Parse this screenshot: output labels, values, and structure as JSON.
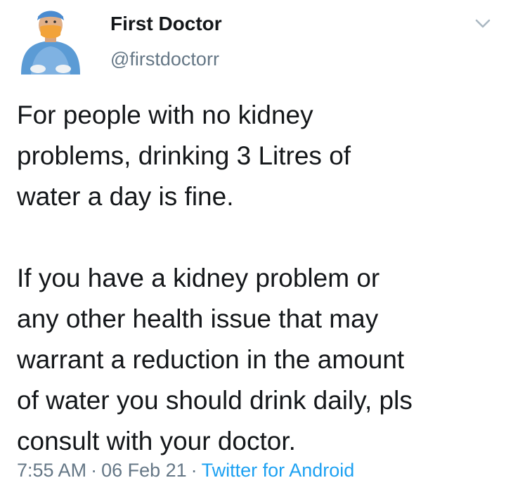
{
  "author": {
    "display_name": "First Doctor",
    "handle": "@firstdoctorr",
    "avatar_icon": "doctor-avatar-icon"
  },
  "menu": {
    "icon": "chevron-down-icon"
  },
  "tweet": {
    "paragraphs": [
      "For people with no kidney\nproblems, drinking 3 Litres of\nwater a day is fine.",
      "If you have a kidney problem or\nany other health issue that may\nwarrant a reduction in the amount\nof water you should drink daily, pls\nconsult with your doctor."
    ]
  },
  "meta": {
    "time": "7:55 AM",
    "date": "06 Feb 21",
    "separator": "·",
    "source": "Twitter for Android"
  },
  "colors": {
    "text": "#14171a",
    "secondary": "#657786",
    "link": "#1da1f2",
    "background": "#ffffff"
  }
}
